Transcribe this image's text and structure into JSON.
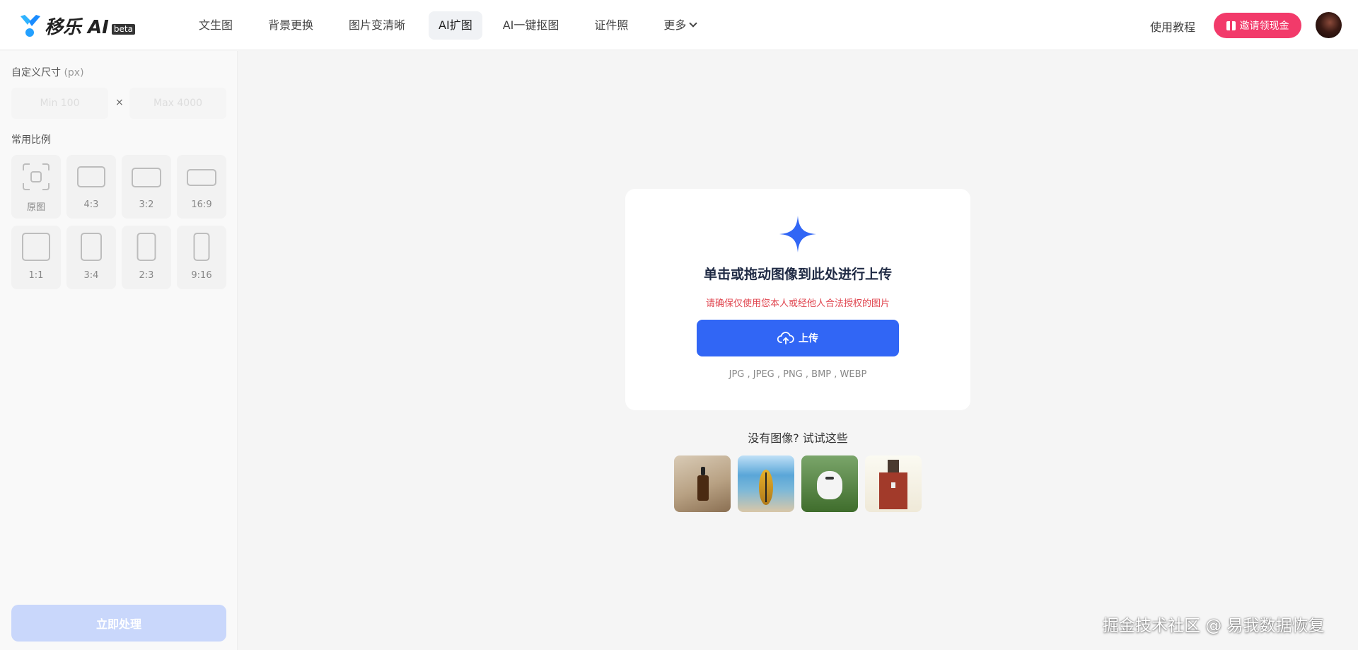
{
  "header": {
    "logo_text": "移乐 AI",
    "logo_badge": "beta",
    "nav": [
      {
        "label": "文生图"
      },
      {
        "label": "背景更换"
      },
      {
        "label": "图片变清晰"
      },
      {
        "label": "AI扩图",
        "active": true
      },
      {
        "label": "AI一键抠图"
      },
      {
        "label": "证件照"
      },
      {
        "label": "更多"
      }
    ],
    "tutorial_label": "使用教程",
    "invite_label": "邀请领现金"
  },
  "sidebar": {
    "custom_size_title": "自定义尺寸",
    "custom_size_unit": "(px)",
    "min_placeholder": "Min 100",
    "max_placeholder": "Max 4000",
    "times_sign": "×",
    "ratio_title": "常用比例",
    "ratios": [
      {
        "label": "原图"
      },
      {
        "label": "4:3"
      },
      {
        "label": "3:2"
      },
      {
        "label": "16:9"
      },
      {
        "label": "1:1"
      },
      {
        "label": "3:4"
      },
      {
        "label": "2:3"
      },
      {
        "label": "9:16"
      }
    ],
    "process_label": "立即处理"
  },
  "upload": {
    "title": "单击或拖动图像到此处进行上传",
    "warning": "请确保仅使用您本人或经他人合法授权的图片",
    "button_label": "上传",
    "formats": "JPG , JPEG , PNG , BMP , WEBP"
  },
  "samples": {
    "title": "没有图像? 试试这些"
  },
  "watermark": "掘金技术社区 @ 易我数据恢复",
  "colors": {
    "primary": "#3166f5",
    "invite": "#f23a6a",
    "warning": "#e0454f",
    "process_disabled": "#c9d7fb"
  }
}
